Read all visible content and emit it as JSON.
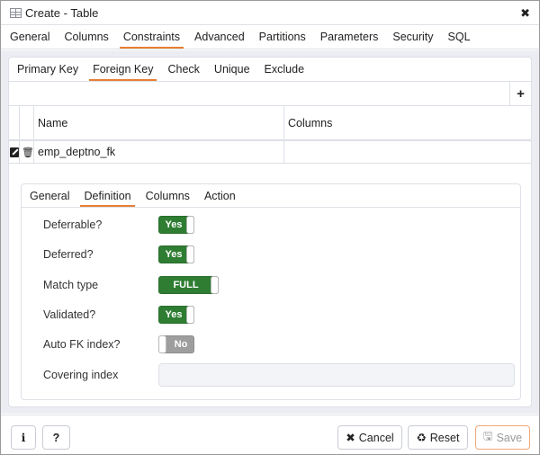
{
  "window": {
    "title": "Create - Table",
    "icon": "table-icon",
    "close_icon": "close-icon",
    "close_glyph": "✖"
  },
  "tabs": [
    {
      "label": "General",
      "active": false
    },
    {
      "label": "Columns",
      "active": false
    },
    {
      "label": "Constraints",
      "active": true
    },
    {
      "label": "Advanced",
      "active": false
    },
    {
      "label": "Partitions",
      "active": false
    },
    {
      "label": "Parameters",
      "active": false
    },
    {
      "label": "Security",
      "active": false
    },
    {
      "label": "SQL",
      "active": false
    }
  ],
  "constraint_tabs": [
    {
      "label": "Primary Key",
      "active": false
    },
    {
      "label": "Foreign Key",
      "active": true
    },
    {
      "label": "Check",
      "active": false
    },
    {
      "label": "Unique",
      "active": false
    },
    {
      "label": "Exclude",
      "active": false
    }
  ],
  "grid": {
    "add_glyph": "+",
    "columns": [
      "Name",
      "Columns"
    ],
    "rows": [
      {
        "name": "emp_deptno_fk",
        "columns": ""
      }
    ]
  },
  "detail_tabs": [
    {
      "label": "General",
      "active": false
    },
    {
      "label": "Definition",
      "active": true
    },
    {
      "label": "Columns",
      "active": false
    },
    {
      "label": "Action",
      "active": false
    }
  ],
  "definition": {
    "deferrable": {
      "label": "Deferrable?",
      "value": "Yes",
      "on": true
    },
    "deferred": {
      "label": "Deferred?",
      "value": "Yes",
      "on": true
    },
    "match_type": {
      "label": "Match type",
      "value": "FULL",
      "on": true
    },
    "validated": {
      "label": "Validated?",
      "value": "Yes",
      "on": true
    },
    "auto_fk_index": {
      "label": "Auto FK index?",
      "value": "No",
      "on": false
    },
    "covering_index": {
      "label": "Covering index",
      "value": ""
    }
  },
  "footer": {
    "info_glyph": "i",
    "help_glyph": "?",
    "cancel": {
      "label": "Cancel",
      "glyph": "✖"
    },
    "reset": {
      "label": "Reset",
      "glyph": "♻"
    },
    "save": {
      "label": "Save",
      "glyph": "🖫"
    }
  },
  "colors": {
    "accent": "#e87e32",
    "switch_on": "#2e7d32",
    "switch_off": "#9e9e9e"
  }
}
